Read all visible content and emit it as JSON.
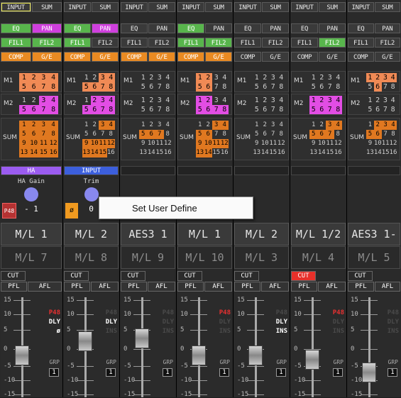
{
  "context_menu": {
    "item": "Set User Define"
  },
  "fader_scale": [
    "15",
    "10",
    "5",
    "0",
    "-5",
    "-10",
    "-15"
  ],
  "sum_cells": [
    "1",
    "2",
    "3",
    "4",
    "5",
    "6",
    "7",
    "8",
    "9",
    "10",
    "11",
    "12",
    "13",
    "14",
    "15",
    "16"
  ],
  "bus_cells": [
    "1",
    "2",
    "3",
    "4",
    "5",
    "6",
    "7",
    "8"
  ],
  "labels": {
    "m1": "M1",
    "m2": "M2",
    "sum": "SUM",
    "grp": "GRP",
    "cut": "CUT",
    "pfl": "PFL",
    "afl": "AFL",
    "input": "INPUT",
    "sumbtn": "SUM",
    "eq": "EQ",
    "pan": "PAN",
    "fil1": "FIL1",
    "fil2": "FIL2",
    "comp": "COMP",
    "ge": "G/E",
    "p48": "P48",
    "dly": "DLY",
    "ins": "INS",
    "phi": "ø"
  },
  "strips": [
    {
      "name1": "M/L 1",
      "name2": "M/L 7",
      "assign": "HA",
      "knob_title": "HA Gain",
      "knob_value": "- 1",
      "p48_btn": true,
      "flags": [
        "P48",
        "DLY",
        "ø"
      ],
      "grp": "1",
      "cut_on": false
    },
    {
      "name1": "M/L 2",
      "name2": "M/L 8",
      "assign": "INPUT",
      "knob_title": "Trim",
      "knob_value": "0",
      "phi_btn": true,
      "flags": [
        "P48",
        "DLY",
        "INS"
      ],
      "grp": "1",
      "cut_on": false
    },
    {
      "name1": "AES3 1",
      "name2": "M/L 9",
      "assign": "",
      "flags": [
        "P48",
        "DLY",
        "INS"
      ],
      "grp": "1",
      "cut_on": false
    },
    {
      "name1": "M/L 1",
      "name2": "M/L 10",
      "assign": "",
      "flags": [
        "P48",
        "DLY",
        "INS"
      ],
      "grp": "1",
      "cut_on": false
    },
    {
      "name1": "M/L 2",
      "name2": "M/L 3",
      "assign": "",
      "flags": [
        "P48",
        "DLY",
        "INS"
      ],
      "grp": "1",
      "cut_on": false
    },
    {
      "name1": "M/L 1/2",
      "name2": "M/L 4",
      "assign": "",
      "flags": [
        "P48",
        "DLY",
        "INS"
      ],
      "grp": "1",
      "cut_on": true
    },
    {
      "name1": "AES3 1-1",
      "name2": "M/L 5",
      "assign": "",
      "flags": [
        "P48",
        "DLY",
        "INS"
      ],
      "grp": "1",
      "cut_on": false
    }
  ]
}
